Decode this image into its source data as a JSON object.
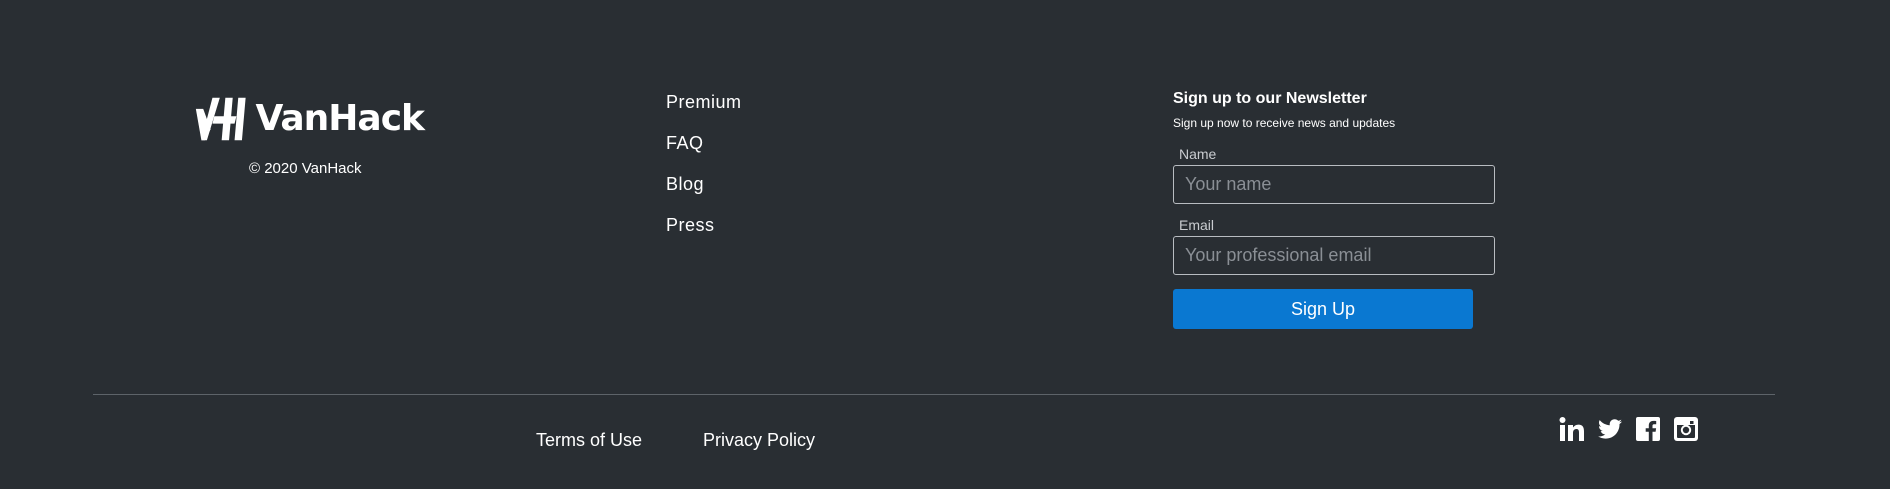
{
  "brand": {
    "name": "VanHack",
    "copyright": "© 2020 VanHack"
  },
  "nav": {
    "links": [
      {
        "label": "Premium"
      },
      {
        "label": "FAQ"
      },
      {
        "label": "Blog"
      },
      {
        "label": "Press"
      }
    ]
  },
  "newsletter": {
    "title": "Sign up to our Newsletter",
    "subtitle": "Sign up now to receive news and updates",
    "name_label": "Name",
    "name_placeholder": "Your name",
    "name_value": "",
    "email_label": "Email",
    "email_placeholder": "Your professional email",
    "email_value": "",
    "button_label": "Sign Up"
  },
  "legal": {
    "terms": "Terms of Use",
    "privacy": "Privacy Policy"
  },
  "social": {
    "icons": [
      "linkedin-icon",
      "twitter-icon",
      "facebook-icon",
      "instagram-icon"
    ]
  },
  "colors": {
    "background": "#292e33",
    "accent": "#0a78d1",
    "text": "#ffffff",
    "divider": "#5d6369"
  }
}
